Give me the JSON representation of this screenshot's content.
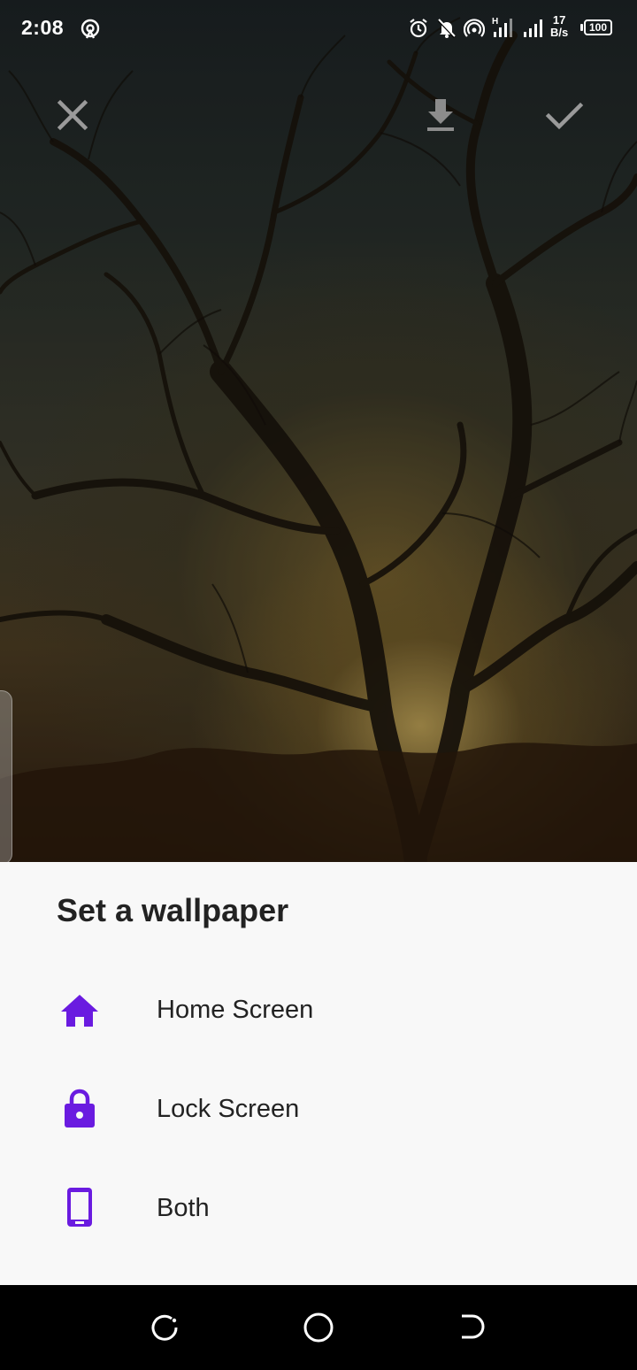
{
  "status_bar": {
    "time": "2:08",
    "net_speed_value": "17",
    "net_speed_unit": "B/s",
    "battery": "100"
  },
  "toolbar": {
    "close_icon": "close-icon",
    "download_icon": "download-icon",
    "apply_icon": "check-icon"
  },
  "sheet": {
    "title": "Set a wallpaper",
    "accent_color": "#6a1be0",
    "options": [
      {
        "label": "Home Screen",
        "icon": "home-icon"
      },
      {
        "label": "Lock Screen",
        "icon": "lock-icon"
      },
      {
        "label": "Both",
        "icon": "phone-icon"
      }
    ]
  },
  "nav_bar": {
    "recents_icon": "recents-icon",
    "home_icon": "home-circle-icon",
    "back_icon": "back-icon"
  }
}
